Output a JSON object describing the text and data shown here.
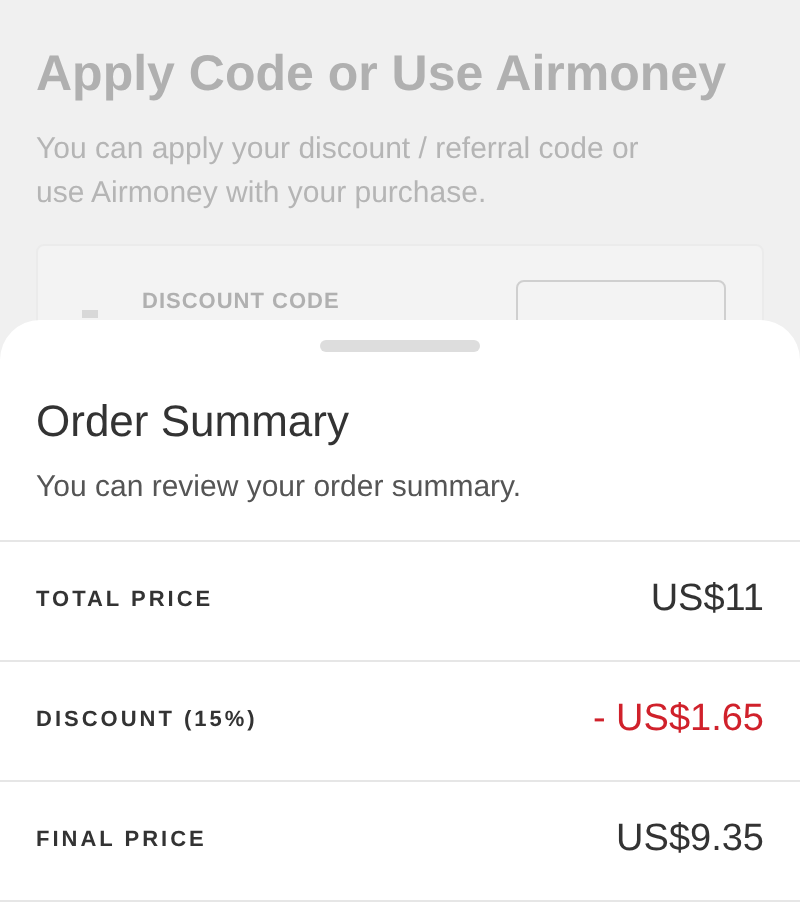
{
  "background": {
    "title": "Apply Code or Use Airmoney",
    "subtitle": "You can apply your discount / referral code or use Airmoney with your purchase.",
    "card": {
      "label": "DISCOUNT CODE"
    }
  },
  "sheet": {
    "title": "Order Summary",
    "subtitle": "You can review your order summary.",
    "rows": [
      {
        "label": "TOTAL PRICE",
        "value": "US$11",
        "kind": "plain"
      },
      {
        "label": "DISCOUNT (15%)",
        "value": "- US$1.65",
        "kind": "deduction"
      },
      {
        "label": "FINAL PRICE",
        "value": "US$9.35",
        "kind": "plain"
      }
    ]
  }
}
